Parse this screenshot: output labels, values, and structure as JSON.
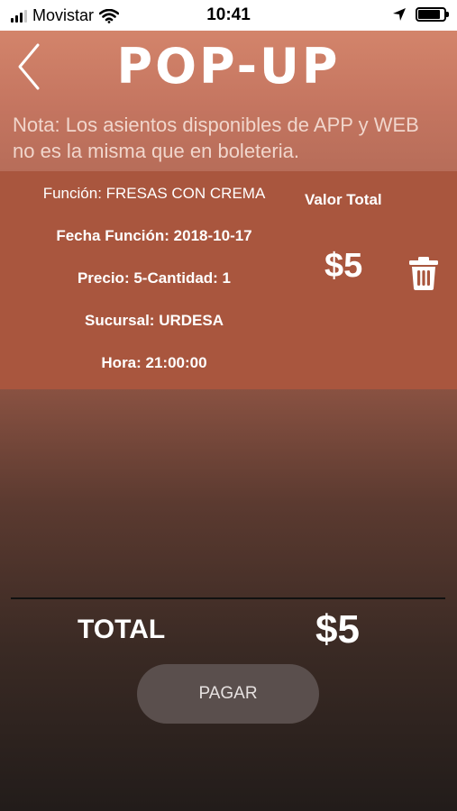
{
  "status_bar": {
    "carrier": "Movistar",
    "time": "10:41",
    "signal_bars_active": 3,
    "signal_bars_total": 4,
    "battery_level": 0.85
  },
  "header": {
    "logo_text": "POP-UP",
    "back_icon": "chevron-left-icon"
  },
  "nota": "Nota: Los asientos disponibles de APP y WEB no es la misma que en boleteria.",
  "ticket": {
    "funcion": "Función: FRESAS CON CREMA",
    "fecha": "Fecha Función: 2018-10-17",
    "precio": "Precio: 5-Cantidad: 1",
    "sucursal": "Sucursal: URDESA",
    "hora": "Hora: 21:00:00",
    "valor_total_label": "Valor Total",
    "valor_total": "$5",
    "delete_icon": "trash-icon"
  },
  "summary": {
    "total_label": "TOTAL",
    "total_value": "$5",
    "pay_label": "PAGAR"
  },
  "colors": {
    "card": "#a9563e",
    "pay_button": "#5a4f4d"
  }
}
